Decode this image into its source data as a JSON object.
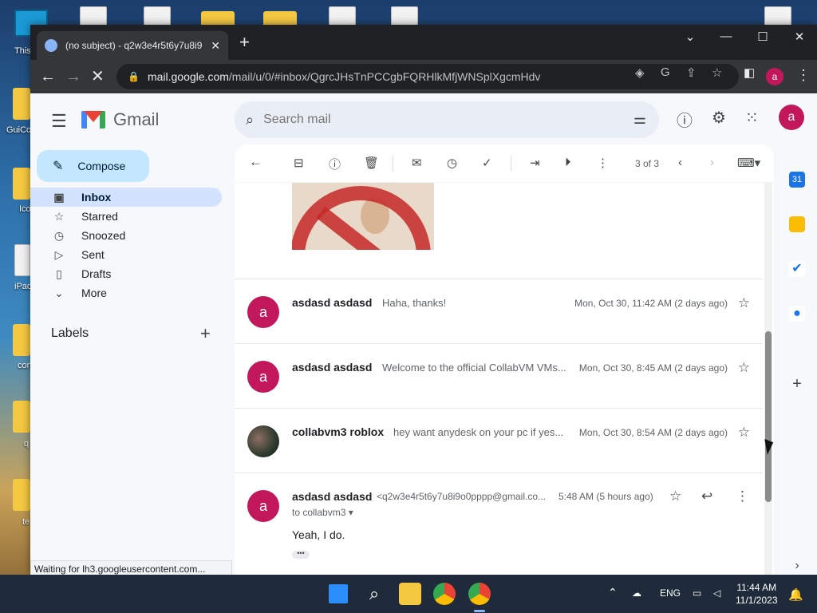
{
  "desktop": {
    "labels": [
      "This",
      "GuiCo",
      "Ico",
      "iPad",
      "con",
      "q",
      "te"
    ]
  },
  "browser": {
    "tab_title": "(no subject) - q2w3e4r5t6y7u8i9",
    "url_domain": "mail.google.com",
    "url_path": "/mail/u/0/#inbox/QgrcJHsTnPCCgbFQRHlkMfjWNSplXgcmHdv",
    "profile_initial": "a"
  },
  "gmail": {
    "brand": "Gmail",
    "search_placeholder": "Search mail",
    "avatar_initial": "a",
    "compose_label": "Compose",
    "nav": [
      {
        "label": "Inbox",
        "icon": "inbox-icon",
        "active": true
      },
      {
        "label": "Starred",
        "icon": "star-icon"
      },
      {
        "label": "Snoozed",
        "icon": "clock-icon"
      },
      {
        "label": "Sent",
        "icon": "send-icon"
      },
      {
        "label": "Drafts",
        "icon": "draft-icon"
      },
      {
        "label": "More",
        "icon": "chevron-down-icon"
      }
    ],
    "labels_heading": "Labels",
    "toolbar": {
      "page_count": "3 of 3"
    },
    "messages": [
      {
        "initial": "a",
        "sender": "asdasd asdasd",
        "snippet": "Haha, thanks!",
        "date": "Mon, Oct 30, 11:42 AM (2 days ago)"
      },
      {
        "initial": "a",
        "sender": "asdasd asdasd",
        "snippet": "Welcome to the official CollabVM VMs...",
        "date": "Mon, Oct 30, 8:45 AM (2 days ago)"
      },
      {
        "initial": "",
        "sender": "collabvm3 roblox",
        "snippet": "hey want anydesk on your pc if yes...",
        "date": "Mon, Oct 30, 8:54 AM (2 days ago)"
      }
    ],
    "open_message": {
      "initial": "a",
      "sender": "asdasd asdasd",
      "email": "<q2w3e4r5t6y7u8i9o0pppp@gmail.co...",
      "date": "5:48 AM (5 hours ago)",
      "to_line": "to collabvm3",
      "body": "Yeah, I do."
    },
    "status_text": "Waiting for lh3.googleusercontent.com..."
  },
  "taskbar": {
    "language": "ENG",
    "time": "11:44 AM",
    "date": "11/1/2023"
  },
  "colors": {
    "accent": "#c2185b",
    "compose_bg": "#c2e7ff",
    "active_nav": "#d3e3fd"
  }
}
